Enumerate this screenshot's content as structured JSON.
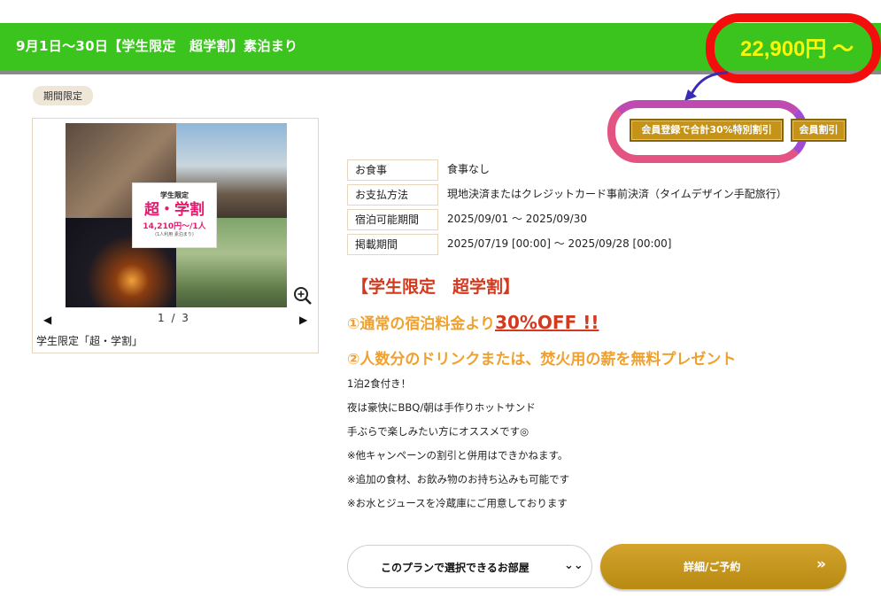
{
  "plan": {
    "title": "9月1日～30日【学生限定　超学割】素泊まり",
    "price": "22,900円 ～",
    "badge": "期間限定"
  },
  "gallery": {
    "promo": {
      "line1": "学生限定",
      "line2": "超・学割",
      "line3": "14,210円～/1人",
      "line4": "(1人利用 素泊まり)"
    },
    "pager": "1 / 3",
    "caption": "学生限定「超・学割」"
  },
  "discounts": {
    "member_total": "会員登録で合計30%特別割引",
    "member": "会員割引"
  },
  "info_rows": [
    {
      "key": "お食事",
      "value": "食事なし"
    },
    {
      "key": "お支払方法",
      "value": "現地決済またはクレジットカード事前決済（タイムデザイン手配旅行）"
    },
    {
      "key": "宿泊可能期間",
      "value": "2025/09/01 ～ 2025/09/30"
    },
    {
      "key": "掲載期間",
      "value": "2025/07/19 [00:00] ～ 2025/09/28 [00:00]"
    }
  ],
  "headline": "【学生限定　超学割】",
  "benefit1_prefix": "①通常の宿泊料金より",
  "benefit1_off": "30%OFF !!",
  "benefit2": "②人数分のドリンクまたは、焚火用の薪を無料プレゼント",
  "description": [
    "1泊2食付き！",
    "夜は豪快にBBQ/朝は手作りホットサンド",
    "手ぶらで楽しみたい方にオススメです◎",
    "※他キャンペーンの割引と併用はできかねます。",
    "※追加の食材、お飲み物のお持ち込みも可能です",
    "※お水とジュースを冷蔵庫にご用意しております"
  ],
  "actions": {
    "rooms": "このプランで選択できるお部屋",
    "reserve": "詳細/ご予約"
  },
  "colors": {
    "header_green": "#3ac41d",
    "price_yellow": "#f7f70a",
    "annotation_red": "#f40d0d",
    "gold": "#c49318",
    "headline_red": "#d23a1f",
    "orange": "#f0a02c"
  },
  "icons": [
    "zoom-in-icon",
    "arrow-left-icon",
    "arrow-right-icon",
    "chevron-double-down-icon",
    "chevron-double-right-icon",
    "curved-arrow-annotation"
  ]
}
